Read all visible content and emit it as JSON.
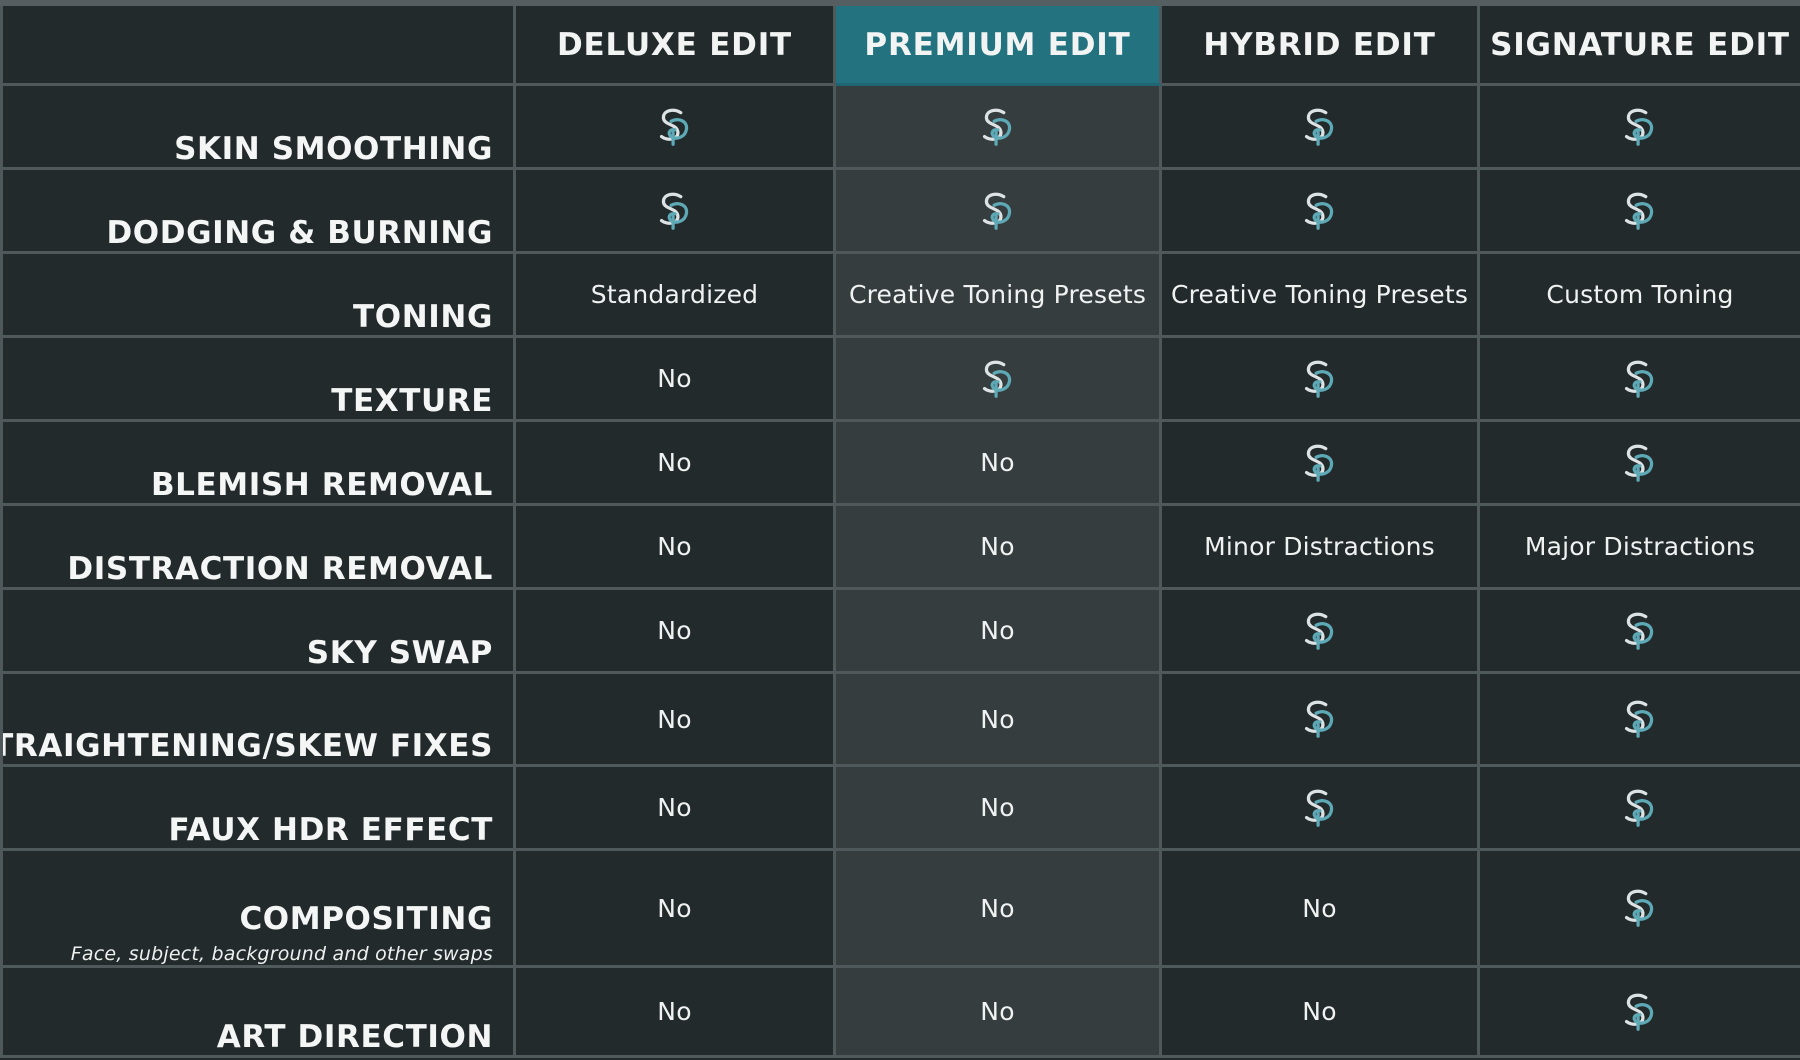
{
  "columns": [
    "DELUXE EDIT",
    "PREMIUM EDIT",
    "HYBRID EDIT",
    "SIGNATURE EDIT"
  ],
  "highlight_column": 1,
  "colors": {
    "background": "#232a2c",
    "highlight_header": "#23727f",
    "highlight_column": "#363d3f",
    "grid_line": "#4f585b",
    "icon_teal": "#5ea9b6",
    "icon_light": "#dde3e4"
  },
  "rows": [
    {
      "label": "SKIN SMOOTHING",
      "values": [
        "icon",
        "icon",
        "icon",
        "icon"
      ]
    },
    {
      "label": "DODGING & BURNING",
      "values": [
        "icon",
        "icon",
        "icon",
        "icon"
      ]
    },
    {
      "label": "TONING",
      "values": [
        "Standardized",
        "Creative Toning Presets",
        "Creative Toning Presets",
        "Custom Toning"
      ]
    },
    {
      "label": "TEXTURE",
      "values": [
        "No",
        "icon",
        "icon",
        "icon"
      ]
    },
    {
      "label": "BLEMISH REMOVAL",
      "values": [
        "No",
        "No",
        "icon",
        "icon"
      ]
    },
    {
      "label": "DISTRACTION REMOVAL",
      "values": [
        "No",
        "No",
        "Minor Distractions",
        "Major Distractions"
      ]
    },
    {
      "label": "SKY SWAP",
      "values": [
        "No",
        "No",
        "icon",
        "icon"
      ]
    },
    {
      "label": "STRAIGHTENING/SKEW FIXES",
      "values": [
        "No",
        "No",
        "icon",
        "icon"
      ]
    },
    {
      "label": "FAUX HDR EFFECT",
      "values": [
        "No",
        "No",
        "icon",
        "icon"
      ]
    },
    {
      "label": "COMPOSITING",
      "sublabel": "Face, subject, background and other swaps",
      "values": [
        "No",
        "No",
        "No",
        "icon"
      ]
    },
    {
      "label": "ART DIRECTION",
      "values": [
        "No",
        "No",
        "No",
        "icon"
      ]
    }
  ],
  "icon_name": "brand-logo-icon"
}
